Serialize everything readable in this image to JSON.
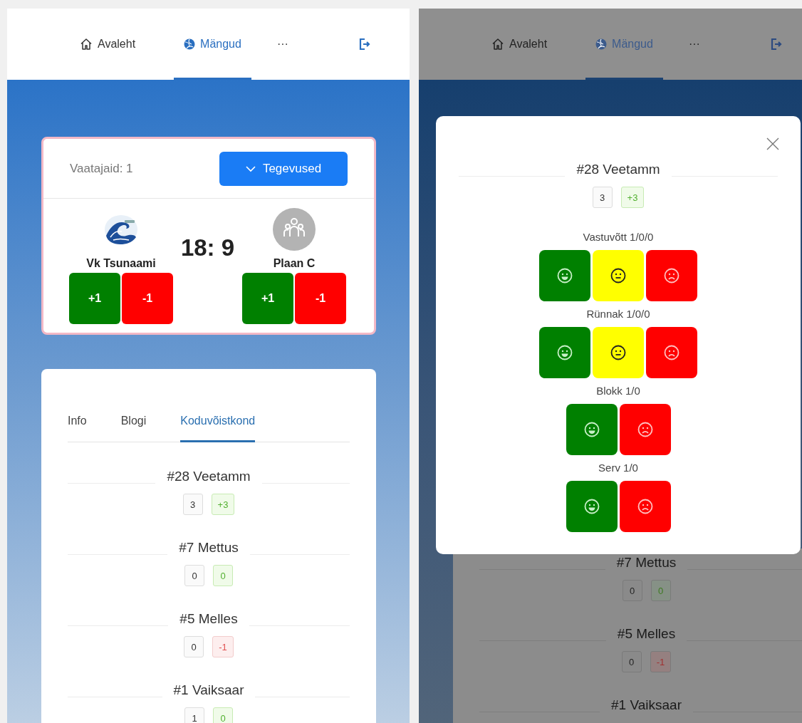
{
  "screens": [
    {
      "header": {
        "nav": [
          {
            "kind": "home",
            "label": "Avaleht",
            "selected": false
          },
          {
            "kind": "games",
            "label": "Mängud",
            "selected": true
          },
          {
            "kind": "more",
            "label": "···",
            "selected": false
          },
          {
            "kind": "logout",
            "selected": false
          }
        ]
      },
      "match_card": {
        "viewers": "Vaatajaid: 1",
        "actions_button": "Tegevused",
        "score": "18: 9",
        "home": {
          "name": "Vk Tsunaami",
          "logo": {
            "kind": "wave"
          },
          "buttons": [
            "+1",
            "-1"
          ]
        },
        "away": {
          "name": "Plaan C",
          "logo": {
            "kind": "group"
          },
          "buttons": [
            "+1",
            "-1"
          ]
        }
      },
      "team_panel": {
        "tabs": [
          {
            "label": "Info",
            "selected": false
          },
          {
            "label": "Blogi",
            "selected": false
          },
          {
            "label": "Koduvõistkond",
            "selected": true
          }
        ],
        "players": [
          {
            "name": "#28 Veetamm",
            "value": "3",
            "diff": "+3",
            "negative": false
          },
          {
            "name": "#7 Mettus",
            "value": "0",
            "diff": "0",
            "negative": false
          },
          {
            "name": "#5 Melles",
            "value": "0",
            "diff": "-1",
            "negative": true
          },
          {
            "name": "#1 Vaiksaar",
            "value": "1",
            "diff": "0",
            "negative": false
          }
        ]
      }
    },
    {
      "header": {
        "nav": [
          {
            "kind": "home",
            "label": "Avaleht",
            "selected": false
          },
          {
            "kind": "games",
            "label": "Mängud",
            "selected": true
          },
          {
            "kind": "more",
            "label": "···",
            "selected": false
          },
          {
            "kind": "logout",
            "selected": false
          }
        ]
      },
      "team_panel": {
        "players": [
          {
            "name": "#7 Mettus",
            "value": "0",
            "diff": "0",
            "negative": false
          },
          {
            "name": "#5 Melles",
            "value": "0",
            "diff": "-1",
            "negative": true
          },
          {
            "name": "#1 Vaiksaar"
          }
        ]
      },
      "modal": {
        "player": {
          "name": "#28 Veetamm",
          "value": "3",
          "diff": "+3",
          "negative": false
        },
        "groups": [
          {
            "label": "Vastuvõtt 1/0/0",
            "buttons": [
              {
                "kind": "good"
              },
              {
                "kind": "neutral"
              },
              {
                "kind": "bad"
              }
            ]
          },
          {
            "label": "Rünnak 1/0/0",
            "buttons": [
              {
                "kind": "good"
              },
              {
                "kind": "neutral"
              },
              {
                "kind": "bad"
              }
            ]
          },
          {
            "label": "Blokk 1/0",
            "buttons": [
              {
                "kind": "good"
              },
              {
                "kind": "bad"
              }
            ]
          },
          {
            "label": "Serv 1/0",
            "buttons": [
              {
                "kind": "good"
              },
              {
                "kind": "bad"
              }
            ]
          }
        ]
      }
    }
  ]
}
